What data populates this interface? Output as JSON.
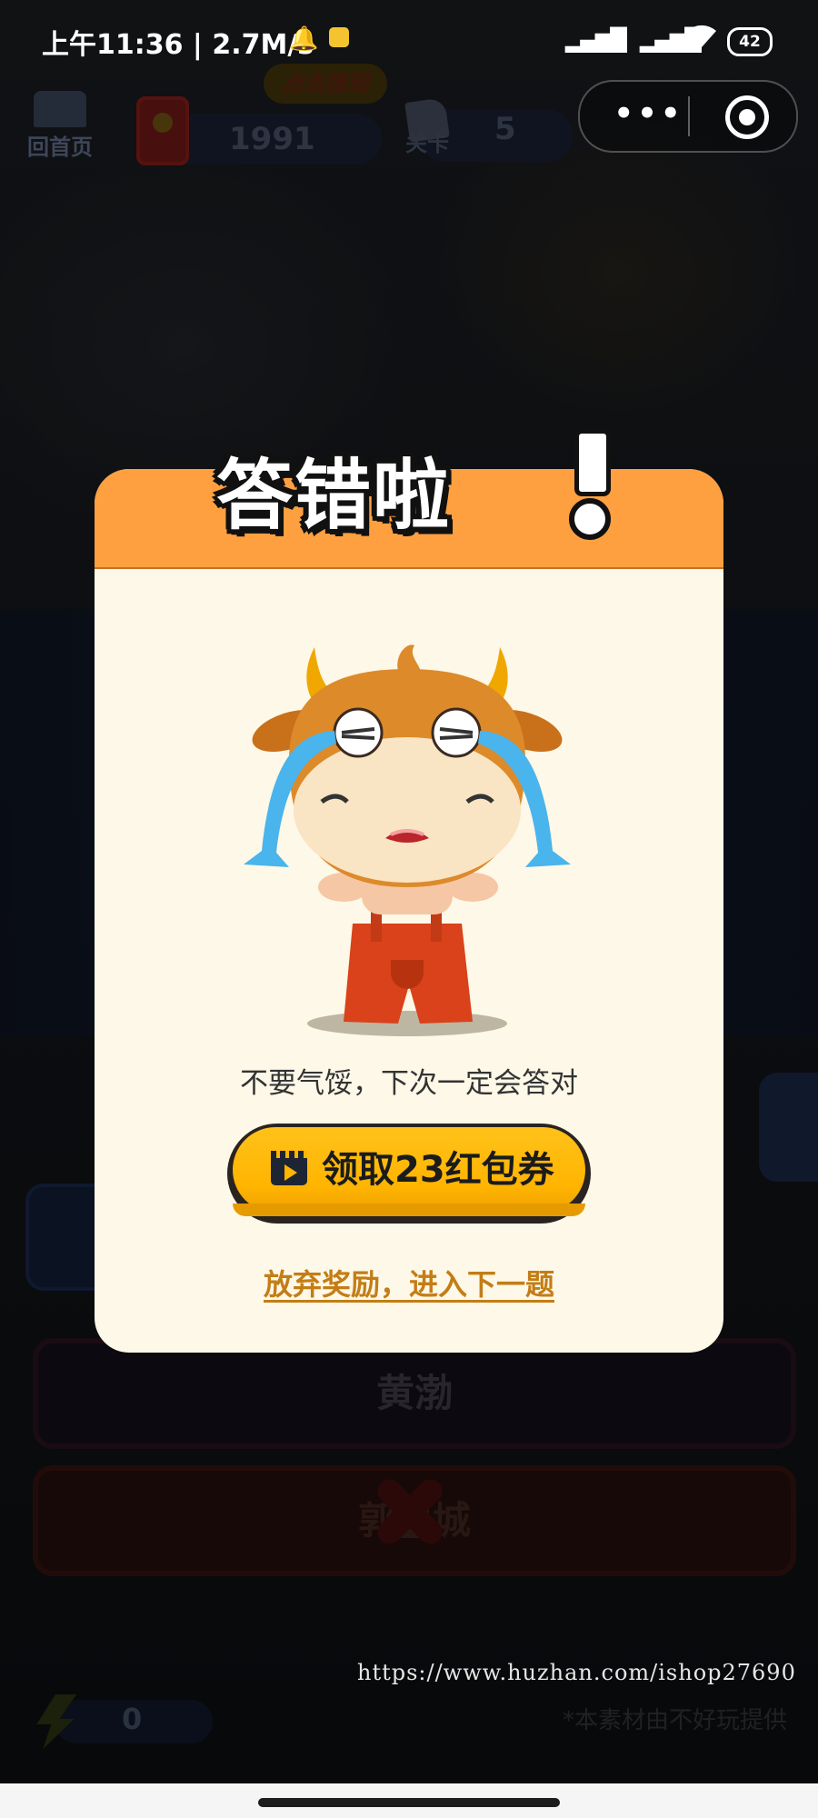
{
  "status_bar": {
    "time_speed": "上午11:36 | 2.7M/s",
    "battery": "42"
  },
  "capsule": {
    "more": "•••"
  },
  "game": {
    "home_label": "回首页",
    "coins": "1991",
    "withdraw_label": "点击提现",
    "level_label": "关卡",
    "level": "5",
    "option_a": "黄渤",
    "option_b": "郭■城",
    "energy": "0",
    "watermark_url": "https://www.huzhan.com/ishop27690",
    "source_note": "*本素材由不好玩提供"
  },
  "dialog": {
    "title": "答错啦",
    "message": "不要气馁，下次一定会答对",
    "claim_button": "领取23红包券",
    "skip_link": "放弃奖励，进入下一题"
  },
  "colors": {
    "header": "#ffa040",
    "dialog_bg": "#fdf8e7",
    "button": "#ffb400",
    "link": "#c47d16"
  }
}
